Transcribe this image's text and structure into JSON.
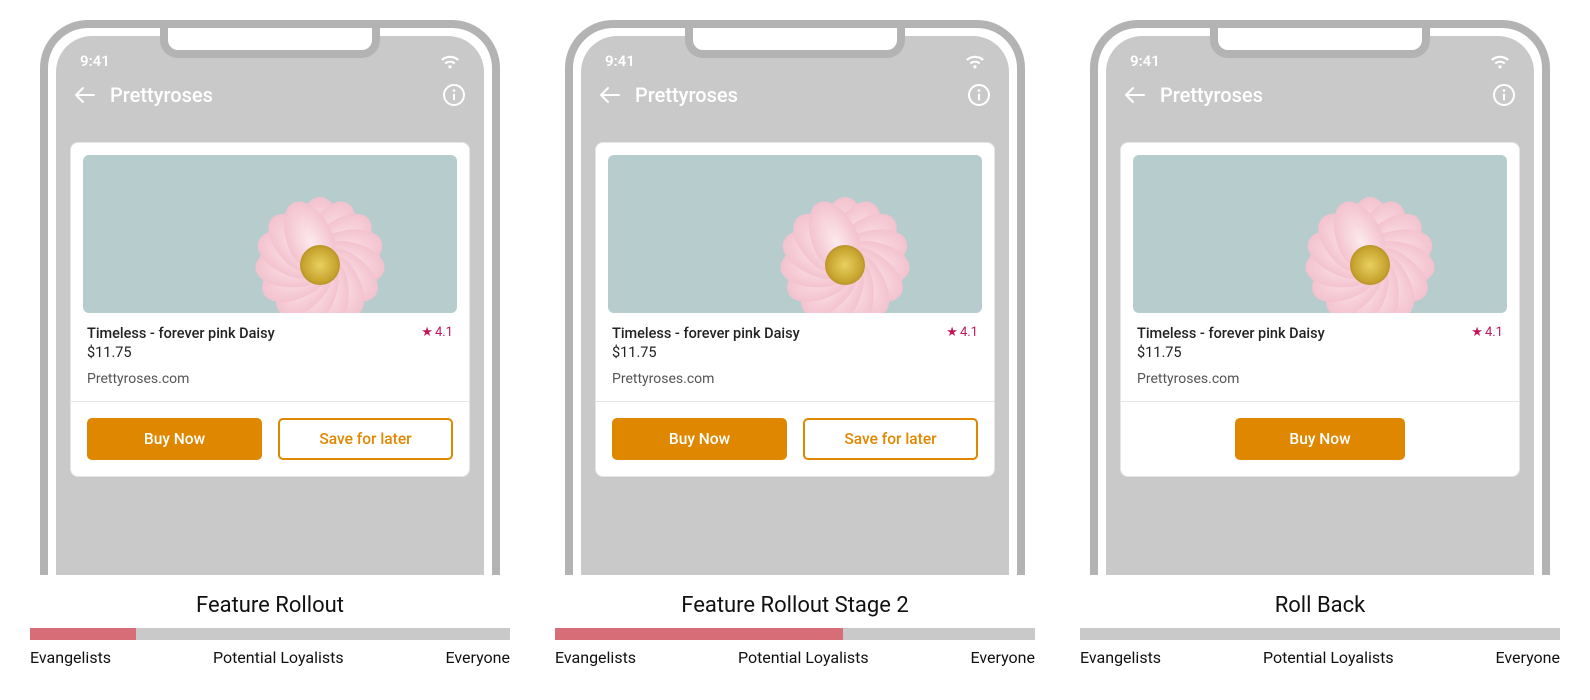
{
  "statusTime": "9:41",
  "appTitle": "Prettyroses",
  "product": {
    "title": "Timeless - forever pink Daisy",
    "rating": "4.1",
    "price": "$11.75",
    "domain": "Prettyroses.com"
  },
  "buttons": {
    "buyNow": "Buy Now",
    "saveLater": "Save for later"
  },
  "segments": {
    "evangelists": "Evangelists",
    "potentialLoyalists": "Potential Loyalists",
    "everyone": "Everyone"
  },
  "stages": [
    {
      "label": "Feature Rollout",
      "progressPercent": 22,
      "showSaveLater": true
    },
    {
      "label": "Feature Rollout Stage 2",
      "progressPercent": 60,
      "showSaveLater": true
    },
    {
      "label": "Roll Back",
      "progressPercent": 0,
      "showSaveLater": false
    }
  ]
}
